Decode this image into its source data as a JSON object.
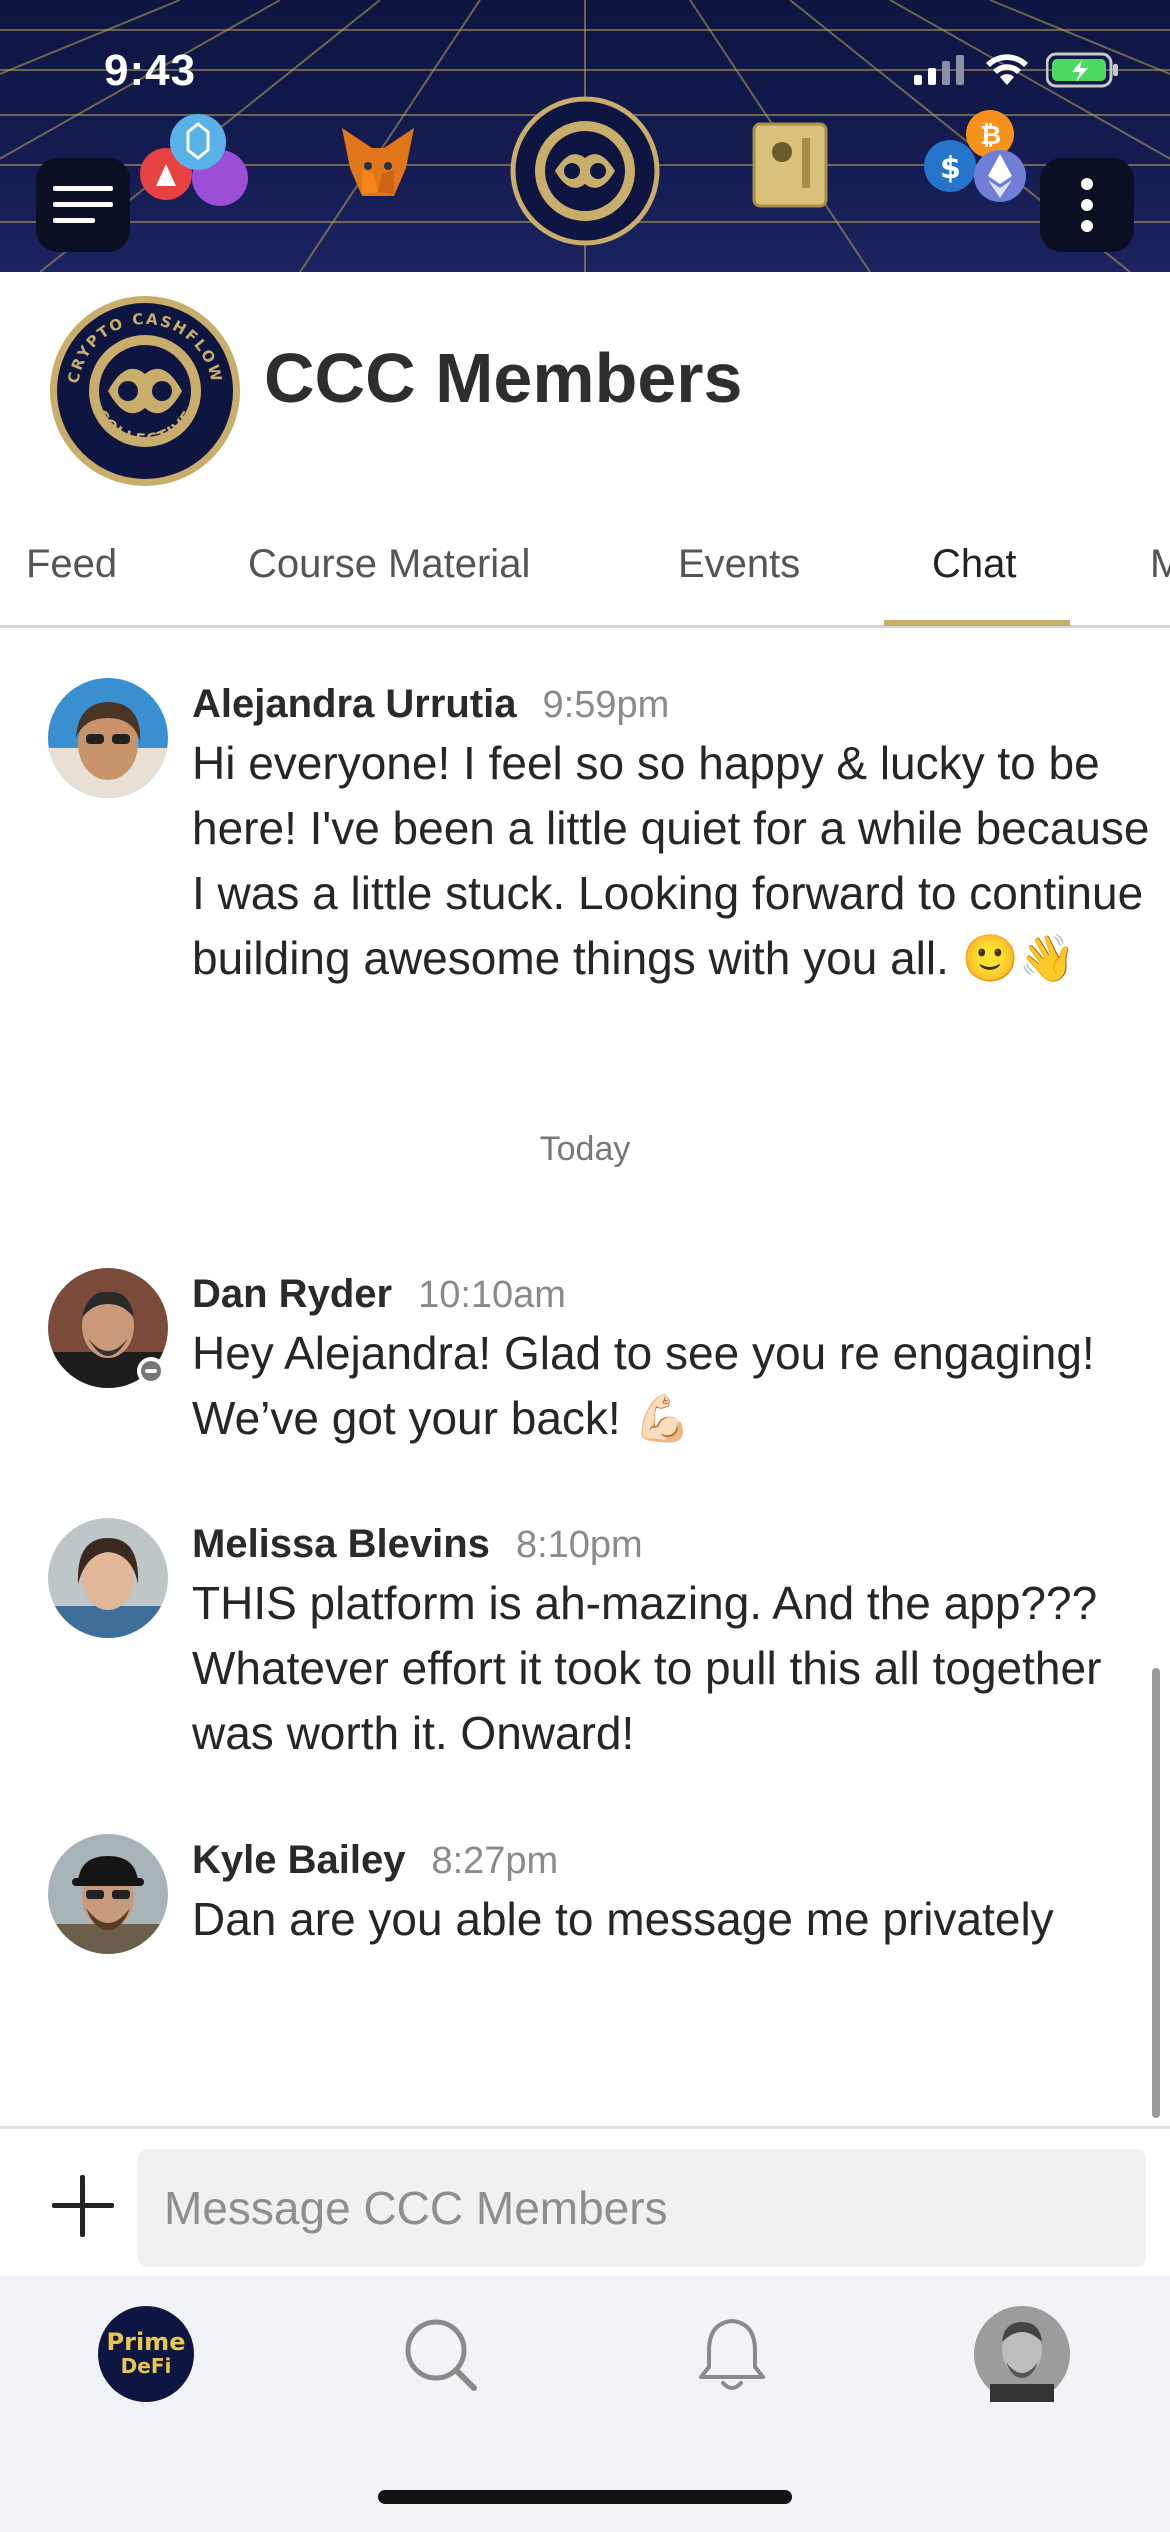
{
  "status_bar": {
    "time": "9:43"
  },
  "group": {
    "title": "CCC Members",
    "logo_text_top": "CRYPTO CASHFLOW",
    "logo_text_bottom": "COLLECTIVE"
  },
  "tabs": [
    {
      "label": "Feed"
    },
    {
      "label": "Course Material"
    },
    {
      "label": "Events"
    },
    {
      "label": "Chat",
      "active": true
    },
    {
      "label": "M"
    }
  ],
  "messages": [
    {
      "name": "Alejandra Urrutia",
      "time": "9:59pm",
      "text": "Hi everyone! I feel so so happy & lucky to be here! I've been a little quiet for a while because I was a little stuck. Looking forward to continue building awesome things with you all. 🙂👋"
    },
    {
      "name": "Dan Ryder",
      "time": "10:10am",
      "text": "Hey Alejandra! Glad to see you re engaging! We’ve got your back! 💪🏻"
    },
    {
      "name": "Melissa Blevins",
      "time": "8:10pm",
      "text": "THIS platform is ah-mazing.  And the app???  Whatever effort it took to pull this all together was worth it.  Onward!"
    },
    {
      "name": "Kyle Bailey",
      "time": "8:27pm",
      "text": "Dan are you able to message me privately"
    }
  ],
  "day_separator": "Today",
  "composer": {
    "placeholder": "Message CCC Members"
  },
  "bottom_nav": {
    "home_logo_line1": "Prime",
    "home_logo_line2": "DeFi"
  },
  "colors": {
    "accent_gold": "#c9ad6a",
    "banner_navy": "#141c52"
  }
}
